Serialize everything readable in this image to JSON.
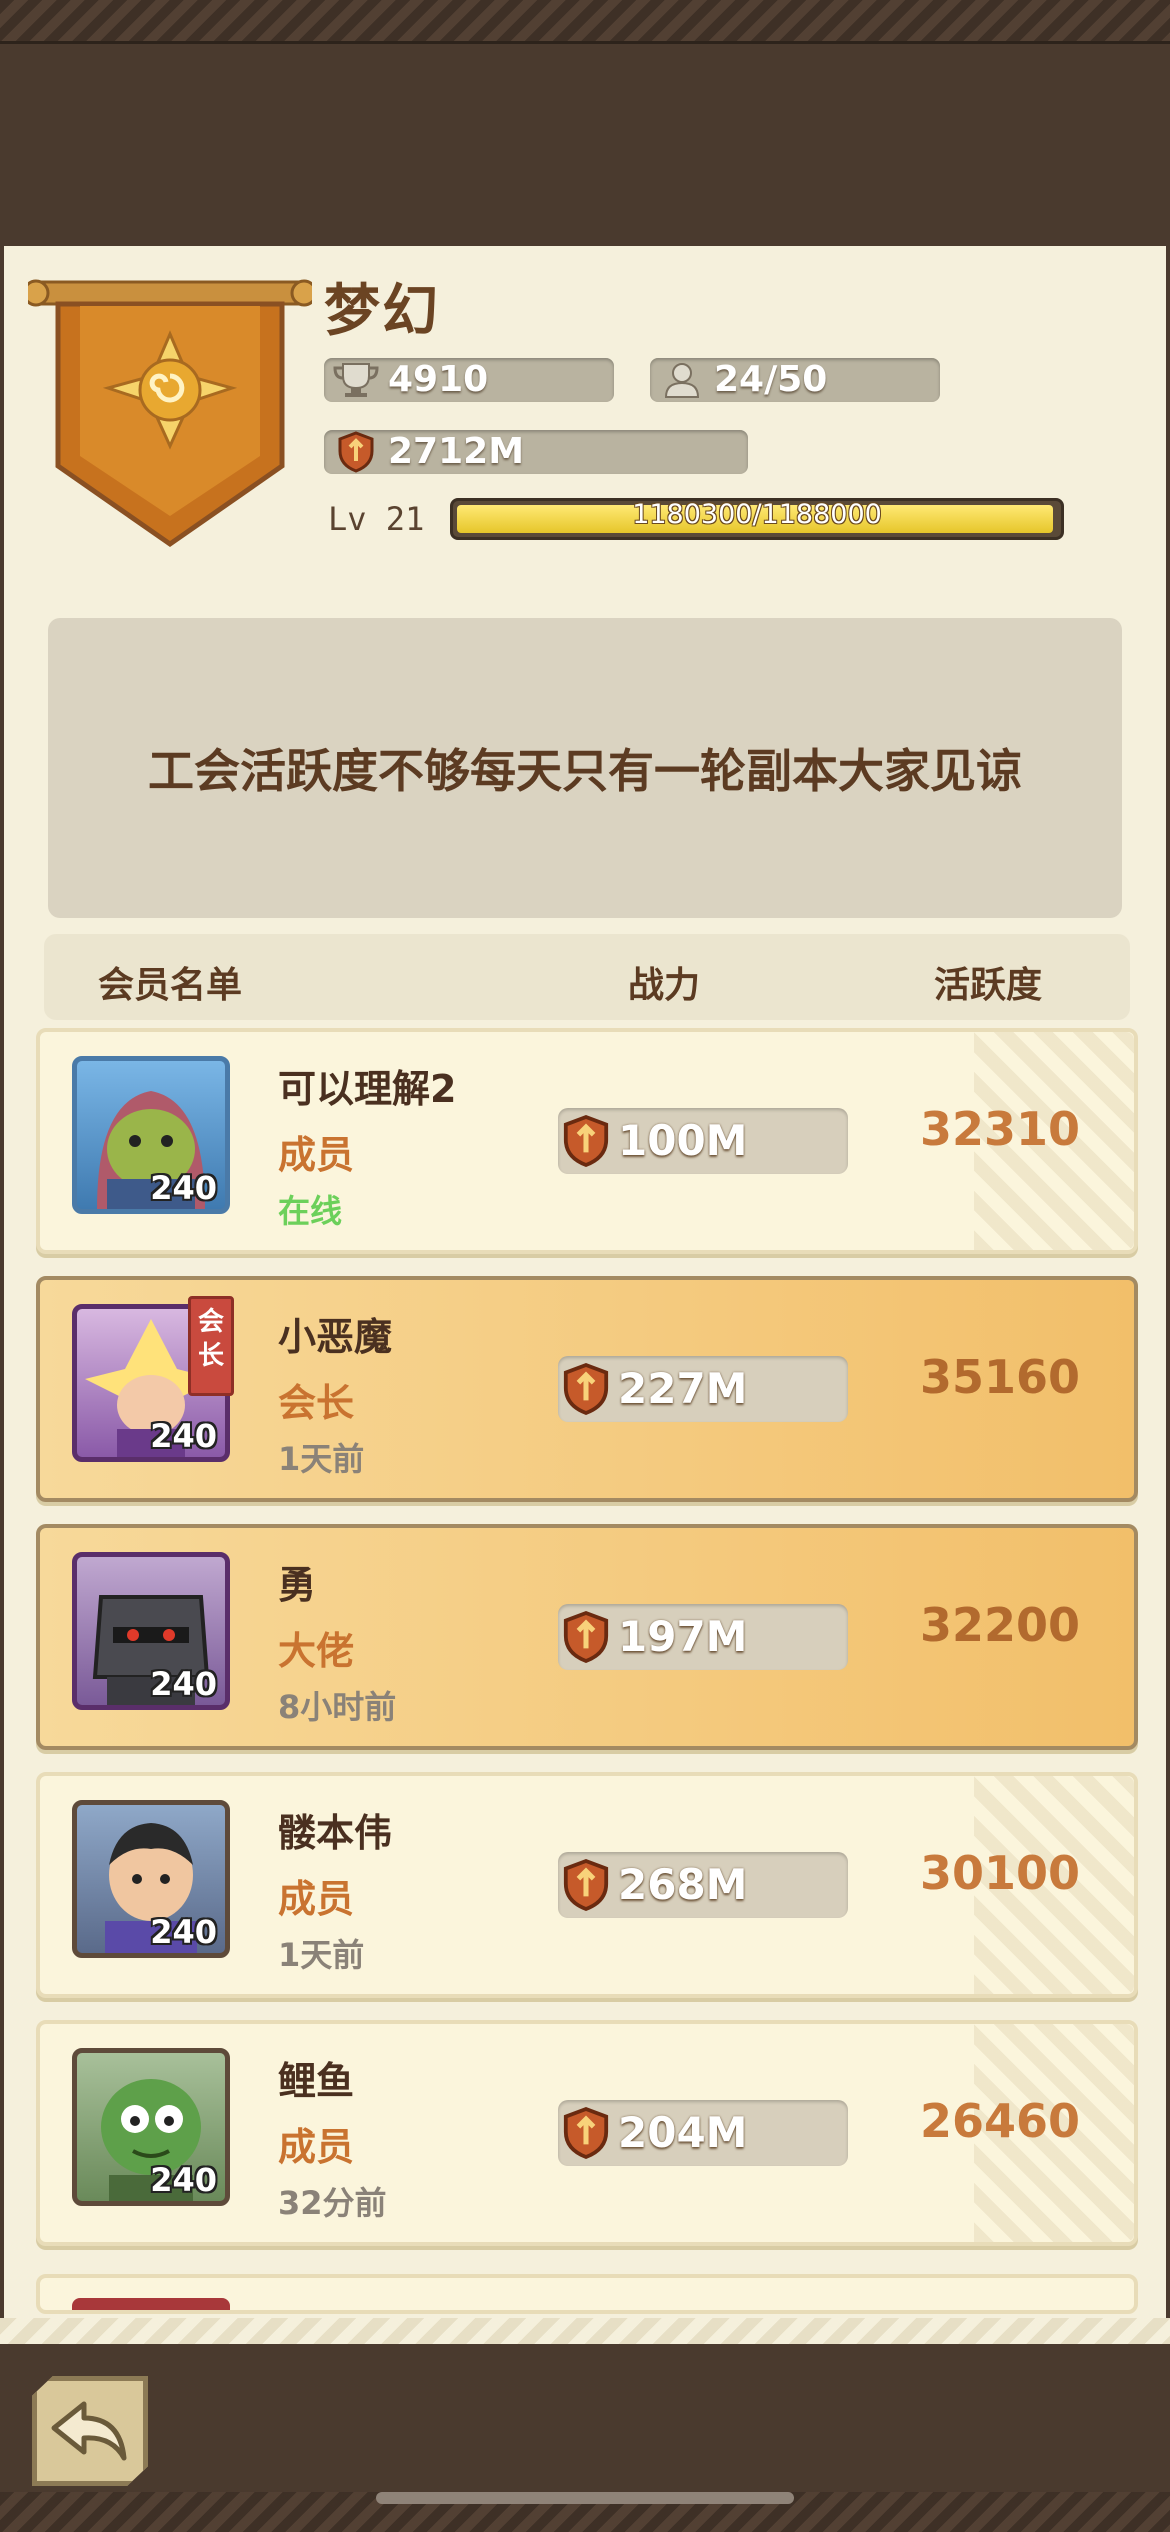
{
  "guild": {
    "name": "梦幻",
    "trophies": "4910",
    "members_count": "24/50",
    "power": "2712M",
    "level_label": "Lv",
    "level": "21",
    "xp_text": "1180300/1188000",
    "xp_progress": 0.9935
  },
  "notice": "工会活跃度不够每天只有一轮副本大家见谅",
  "list_header": {
    "col_name": "会员名单",
    "col_power": "战力",
    "col_activity": "活跃度"
  },
  "members": [
    {
      "name": "可以理解2",
      "role": "成员",
      "status": "在线",
      "level": "240",
      "power": "100M",
      "activity": "32310",
      "online": true,
      "highlight": false
    },
    {
      "name": "小恶魔",
      "role": "会长",
      "status": "1天前",
      "level": "240",
      "power": "227M",
      "activity": "35160",
      "online": false,
      "highlight": true,
      "tag": "会长"
    },
    {
      "name": "勇",
      "role": "大佬",
      "status": "8小时前",
      "level": "240",
      "power": "197M",
      "activity": "32200",
      "online": false,
      "highlight": true
    },
    {
      "name": "髅本伟",
      "role": "成员",
      "status": "1天前",
      "level": "240",
      "power": "268M",
      "activity": "30100",
      "online": false,
      "highlight": false
    },
    {
      "name": "鲤鱼",
      "role": "成员",
      "status": "32分前",
      "level": "240",
      "power": "204M",
      "activity": "26460",
      "online": false,
      "highlight": false
    }
  ],
  "icons": {
    "trophy": "trophy-icon",
    "members": "person-icon",
    "power": "shield-icon",
    "back": "back-arrow-icon"
  },
  "colors": {
    "accent": "#c97330",
    "online": "#6cd05a",
    "panel": "#f5f0dc",
    "frame": "#4a3a2e"
  }
}
